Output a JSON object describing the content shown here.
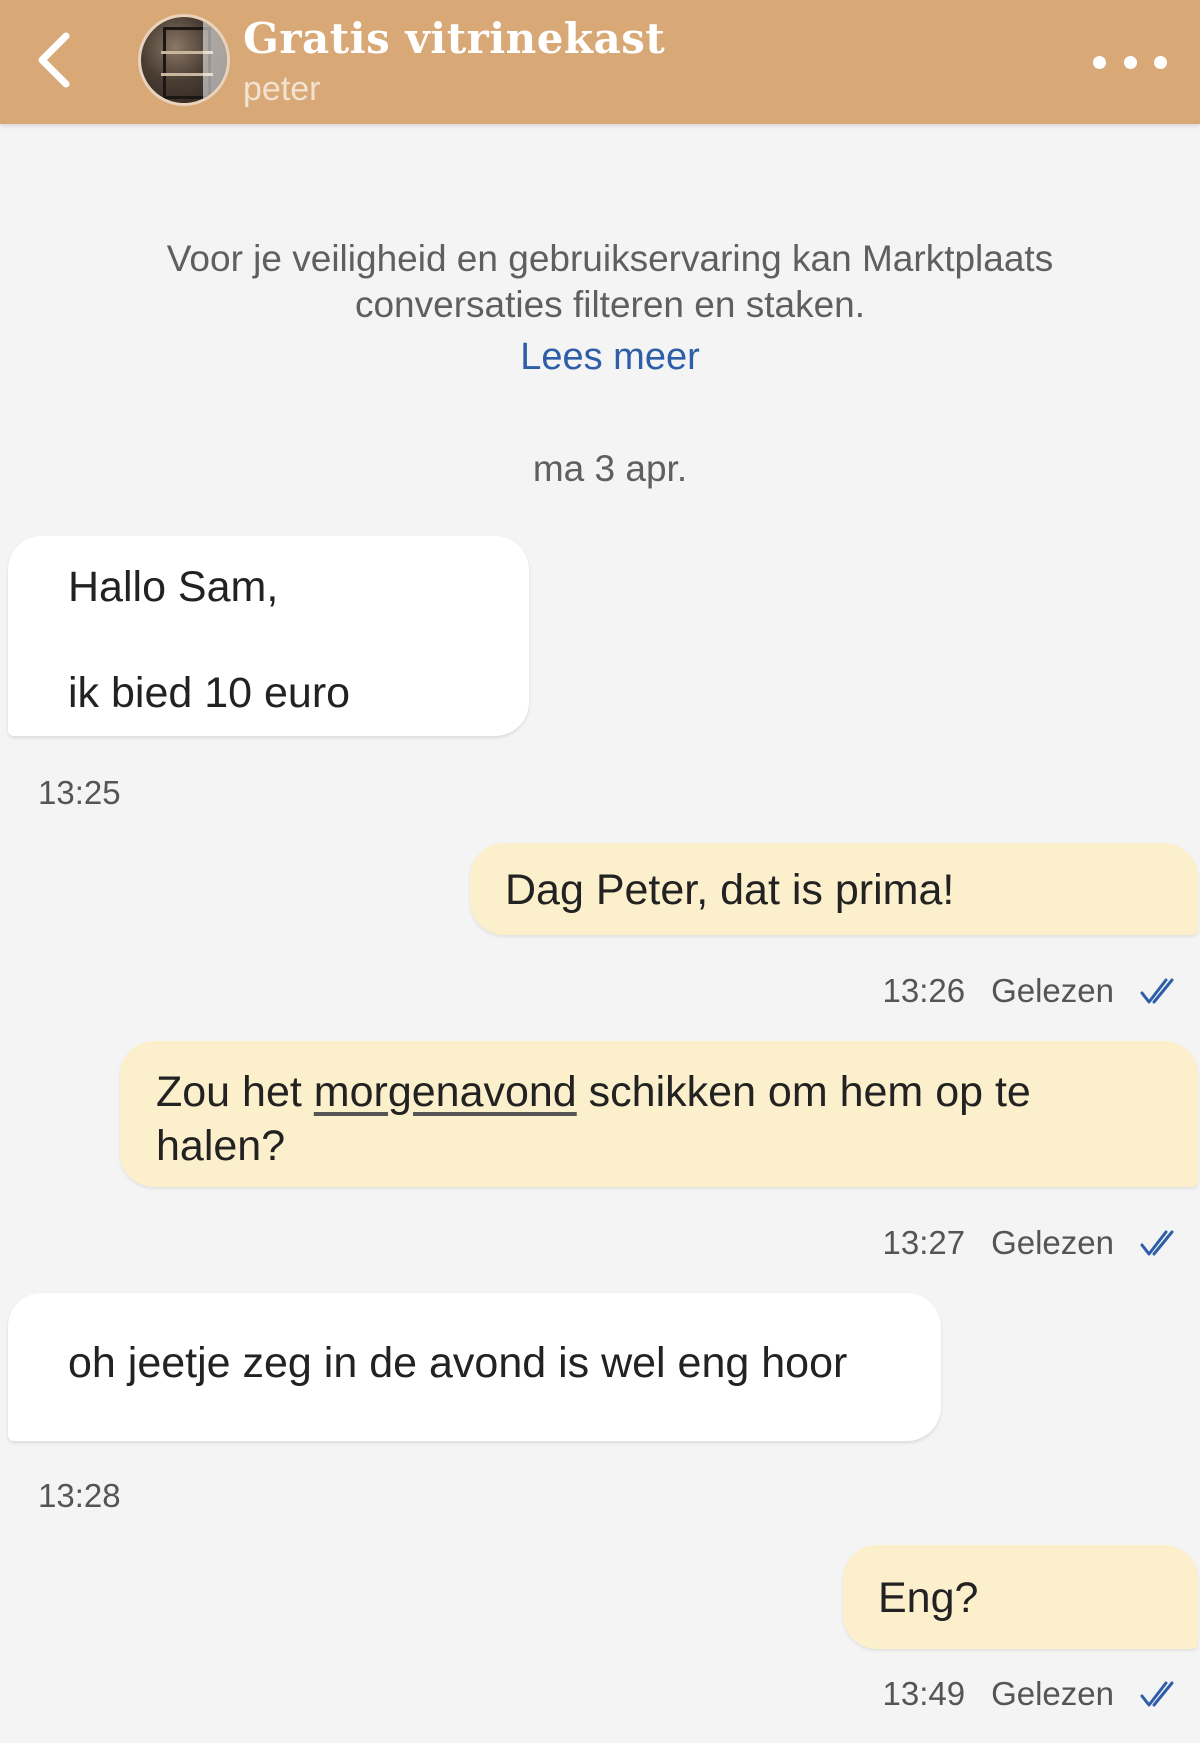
{
  "header": {
    "back_icon": "chevron-left-icon",
    "title": "Gratis vitrinekast",
    "subtitle": "peter",
    "menu_icon": "more-dots-icon",
    "background_color": "#d9a877"
  },
  "notice": {
    "line1": "Voor je veiligheid en gebruikservaring kan Marktplaats",
    "line2": "conversaties filteren en staken.",
    "link": "Lees meer"
  },
  "date_separator": "ma 3 apr.",
  "messages": [
    {
      "direction": "incoming",
      "line1": "Hallo Sam,",
      "line2": "ik bied 10 euro",
      "time": "13:25"
    },
    {
      "direction": "outgoing",
      "text": "Dag Peter, dat is prima!",
      "time": "13:26",
      "status": "Gelezen"
    },
    {
      "direction": "outgoing",
      "text_before": "Zou het ",
      "text_underlined": "morgenavond",
      "text_after": " schikken om hem op te",
      "text_line2": "halen?",
      "time": "13:27",
      "status": "Gelezen"
    },
    {
      "direction": "incoming",
      "text": "oh jeetje zeg in de avond is wel eng hoor",
      "time": "13:28"
    },
    {
      "direction": "outgoing",
      "text": "Eng?",
      "time": "13:49",
      "status": "Gelezen"
    }
  ],
  "colors": {
    "incoming_bubble": "#ffffff",
    "outgoing_bubble": "#fbefcc",
    "link": "#2e5ea8",
    "read_check": "#2e5ea8"
  }
}
